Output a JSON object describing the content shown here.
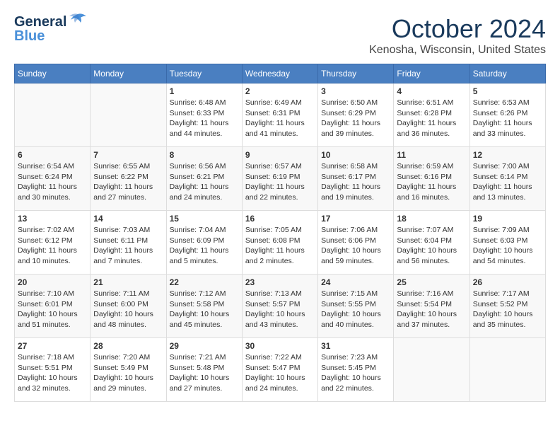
{
  "header": {
    "logo_line1": "General",
    "logo_line2": "Blue",
    "month": "October 2024",
    "location": "Kenosha, Wisconsin, United States"
  },
  "days_of_week": [
    "Sunday",
    "Monday",
    "Tuesday",
    "Wednesday",
    "Thursday",
    "Friday",
    "Saturday"
  ],
  "weeks": [
    [
      {
        "day": "",
        "content": ""
      },
      {
        "day": "",
        "content": ""
      },
      {
        "day": "1",
        "content": "Sunrise: 6:48 AM\nSunset: 6:33 PM\nDaylight: 11 hours\nand 44 minutes."
      },
      {
        "day": "2",
        "content": "Sunrise: 6:49 AM\nSunset: 6:31 PM\nDaylight: 11 hours\nand 41 minutes."
      },
      {
        "day": "3",
        "content": "Sunrise: 6:50 AM\nSunset: 6:29 PM\nDaylight: 11 hours\nand 39 minutes."
      },
      {
        "day": "4",
        "content": "Sunrise: 6:51 AM\nSunset: 6:28 PM\nDaylight: 11 hours\nand 36 minutes."
      },
      {
        "day": "5",
        "content": "Sunrise: 6:53 AM\nSunset: 6:26 PM\nDaylight: 11 hours\nand 33 minutes."
      }
    ],
    [
      {
        "day": "6",
        "content": "Sunrise: 6:54 AM\nSunset: 6:24 PM\nDaylight: 11 hours\nand 30 minutes."
      },
      {
        "day": "7",
        "content": "Sunrise: 6:55 AM\nSunset: 6:22 PM\nDaylight: 11 hours\nand 27 minutes."
      },
      {
        "day": "8",
        "content": "Sunrise: 6:56 AM\nSunset: 6:21 PM\nDaylight: 11 hours\nand 24 minutes."
      },
      {
        "day": "9",
        "content": "Sunrise: 6:57 AM\nSunset: 6:19 PM\nDaylight: 11 hours\nand 22 minutes."
      },
      {
        "day": "10",
        "content": "Sunrise: 6:58 AM\nSunset: 6:17 PM\nDaylight: 11 hours\nand 19 minutes."
      },
      {
        "day": "11",
        "content": "Sunrise: 6:59 AM\nSunset: 6:16 PM\nDaylight: 11 hours\nand 16 minutes."
      },
      {
        "day": "12",
        "content": "Sunrise: 7:00 AM\nSunset: 6:14 PM\nDaylight: 11 hours\nand 13 minutes."
      }
    ],
    [
      {
        "day": "13",
        "content": "Sunrise: 7:02 AM\nSunset: 6:12 PM\nDaylight: 11 hours\nand 10 minutes."
      },
      {
        "day": "14",
        "content": "Sunrise: 7:03 AM\nSunset: 6:11 PM\nDaylight: 11 hours\nand 7 minutes."
      },
      {
        "day": "15",
        "content": "Sunrise: 7:04 AM\nSunset: 6:09 PM\nDaylight: 11 hours\nand 5 minutes."
      },
      {
        "day": "16",
        "content": "Sunrise: 7:05 AM\nSunset: 6:08 PM\nDaylight: 11 hours\nand 2 minutes."
      },
      {
        "day": "17",
        "content": "Sunrise: 7:06 AM\nSunset: 6:06 PM\nDaylight: 10 hours\nand 59 minutes."
      },
      {
        "day": "18",
        "content": "Sunrise: 7:07 AM\nSunset: 6:04 PM\nDaylight: 10 hours\nand 56 minutes."
      },
      {
        "day": "19",
        "content": "Sunrise: 7:09 AM\nSunset: 6:03 PM\nDaylight: 10 hours\nand 54 minutes."
      }
    ],
    [
      {
        "day": "20",
        "content": "Sunrise: 7:10 AM\nSunset: 6:01 PM\nDaylight: 10 hours\nand 51 minutes."
      },
      {
        "day": "21",
        "content": "Sunrise: 7:11 AM\nSunset: 6:00 PM\nDaylight: 10 hours\nand 48 minutes."
      },
      {
        "day": "22",
        "content": "Sunrise: 7:12 AM\nSunset: 5:58 PM\nDaylight: 10 hours\nand 45 minutes."
      },
      {
        "day": "23",
        "content": "Sunrise: 7:13 AM\nSunset: 5:57 PM\nDaylight: 10 hours\nand 43 minutes."
      },
      {
        "day": "24",
        "content": "Sunrise: 7:15 AM\nSunset: 5:55 PM\nDaylight: 10 hours\nand 40 minutes."
      },
      {
        "day": "25",
        "content": "Sunrise: 7:16 AM\nSunset: 5:54 PM\nDaylight: 10 hours\nand 37 minutes."
      },
      {
        "day": "26",
        "content": "Sunrise: 7:17 AM\nSunset: 5:52 PM\nDaylight: 10 hours\nand 35 minutes."
      }
    ],
    [
      {
        "day": "27",
        "content": "Sunrise: 7:18 AM\nSunset: 5:51 PM\nDaylight: 10 hours\nand 32 minutes."
      },
      {
        "day": "28",
        "content": "Sunrise: 7:20 AM\nSunset: 5:49 PM\nDaylight: 10 hours\nand 29 minutes."
      },
      {
        "day": "29",
        "content": "Sunrise: 7:21 AM\nSunset: 5:48 PM\nDaylight: 10 hours\nand 27 minutes."
      },
      {
        "day": "30",
        "content": "Sunrise: 7:22 AM\nSunset: 5:47 PM\nDaylight: 10 hours\nand 24 minutes."
      },
      {
        "day": "31",
        "content": "Sunrise: 7:23 AM\nSunset: 5:45 PM\nDaylight: 10 hours\nand 22 minutes."
      },
      {
        "day": "",
        "content": ""
      },
      {
        "day": "",
        "content": ""
      }
    ]
  ]
}
